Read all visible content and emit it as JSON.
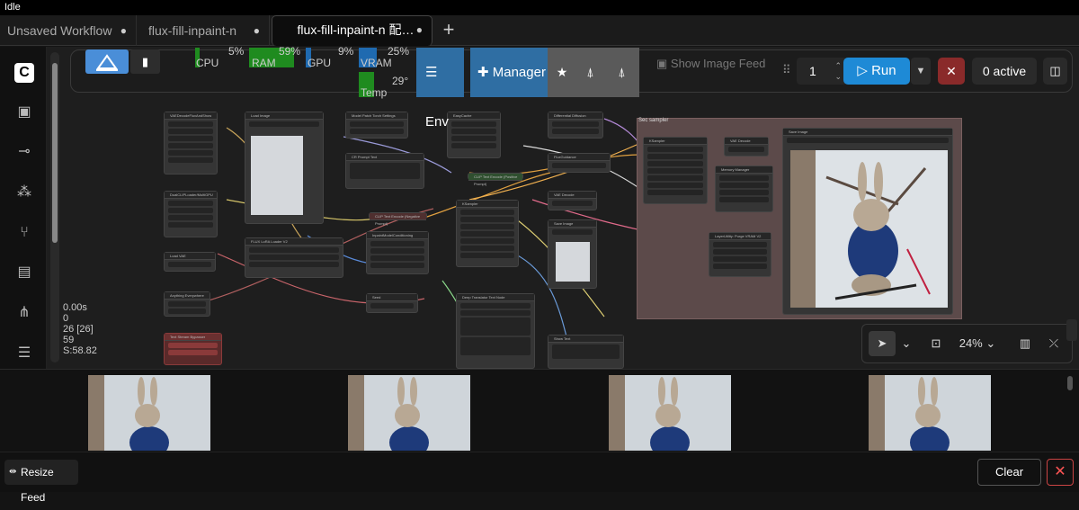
{
  "window": {
    "status": "Idle"
  },
  "tabs": [
    {
      "label": "Unsaved Workflow",
      "modified": "●"
    },
    {
      "label": "flux-fill-inpaint-n",
      "modified": "●"
    },
    {
      "label": "flux-fill-inpaint-n 配…",
      "modified": "●"
    }
  ],
  "tab_add": "+",
  "monitor": {
    "cpu_label": "CPU",
    "cpu_value": "5%",
    "ram_label": "RAM",
    "ram_value": "59%",
    "gpu_label": "GPU",
    "gpu_value": "9%",
    "vram_label": "VRAM",
    "vram_value": "25%",
    "temp_label": "Temp",
    "temp_value": "29°",
    "cpu_level": 0.05,
    "ram_level": 0.59,
    "gpu_level": 0.09,
    "vram_level": 0.25,
    "temp_level": 0.29
  },
  "toolbar": {
    "env_label": "Env",
    "manager_label": "Manager",
    "show_feed_label": "Show Image Feed",
    "queue_count": "1",
    "run_label": "Run",
    "active_label": "0 active"
  },
  "stats": {
    "line1": "0.00s",
    "line2": "0",
    "line3": "26 [26]",
    "line4": "59",
    "line5": "S:58.82"
  },
  "canvas": {
    "group_title": "Sec sampler",
    "zoom": "24%"
  },
  "nodes": [
    "VAEDecodeFluxAndShow",
    "Load Image",
    "Model Patch Torch Settings",
    "EasyCache",
    "Differential Diffusion",
    "DualCLIPLoader/MultiGPU",
    "CR Prompt Text",
    "CLIP Text Encode (Positive Prompt)",
    "FluxGuidance",
    "KSampler",
    "VAE Decode",
    "Save Image",
    "Memory Manager",
    "LayerUtility: Purge VRAM V2",
    "FLUX LoRA Loader V2",
    "InpaintModelConditioning",
    "CLIP Text Encode (Negative Prompt)",
    "Load VAE",
    "Anything Everywhere",
    "Seed",
    "Deep Translator Text Node",
    "Show Text",
    "Text Stream Bypasser"
  ],
  "feed": {
    "resize_label": "Resize Feed",
    "clear_label": "Clear",
    "close_glyph": "✕"
  },
  "icons": {
    "sidebar": [
      "comfy-logo-icon",
      "image-icon",
      "model-icon",
      "node-library-icon",
      "workflow-icon",
      "template-icon",
      "tree-icon",
      "queue-icon"
    ]
  }
}
